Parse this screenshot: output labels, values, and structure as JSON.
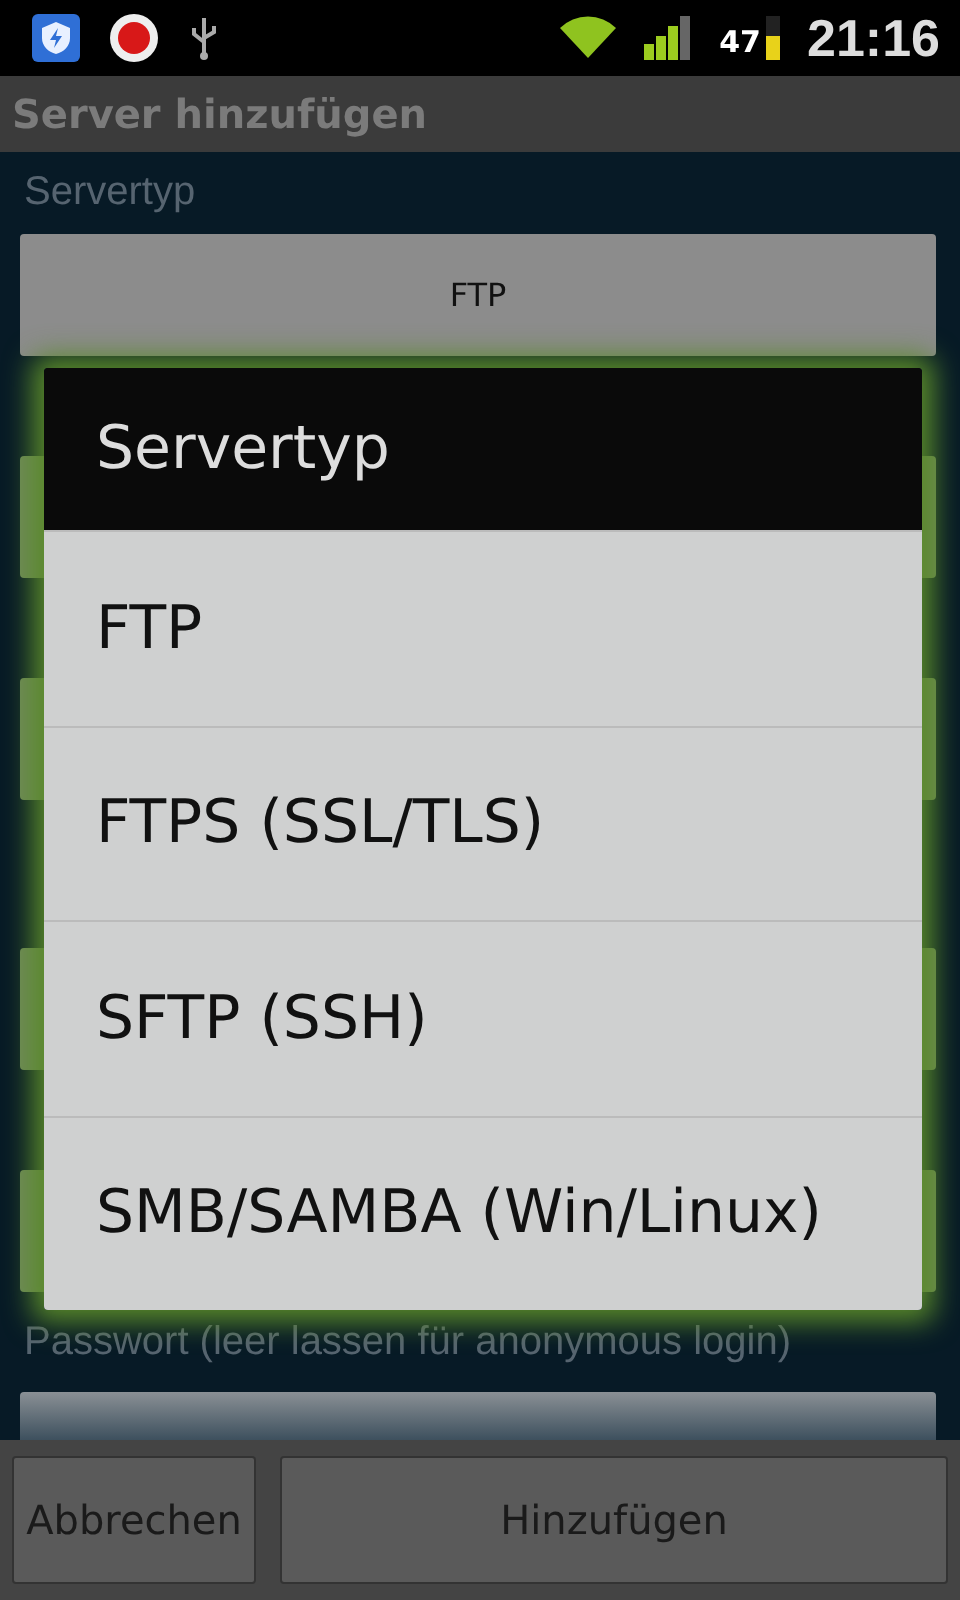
{
  "status_bar": {
    "battery": "47",
    "time": "21:16"
  },
  "title": "Server hinzufügen",
  "form": [
    {
      "kind": "select",
      "label": "Servertyp",
      "value": "FTP"
    },
    {
      "kind": "field"
    },
    {
      "kind": "field"
    },
    {
      "kind": "field"
    },
    {
      "kind": "field"
    },
    {
      "kind": "field",
      "label": "Passwort (leer lassen für anonymous login)"
    }
  ],
  "dialog": {
    "title": "Servertyp",
    "items": [
      "FTP",
      "FTPS (SSL/TLS)",
      "SFTP (SSH)",
      "SMB/SAMBA (Win/Linux)"
    ]
  },
  "buttons": [
    {
      "label": "Abbrechen"
    },
    {
      "label": "Hinzufügen"
    }
  ]
}
